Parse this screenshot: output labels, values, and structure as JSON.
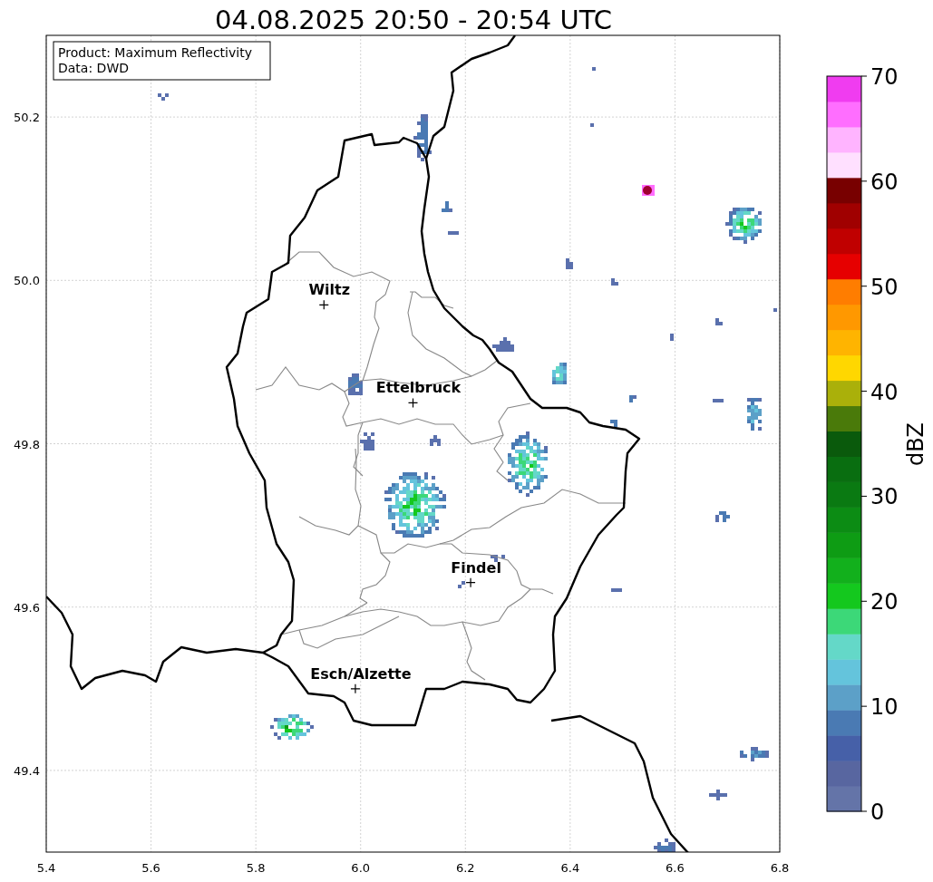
{
  "info_box": {
    "lines": [
      "Product: Maximum Reflectivity",
      "Data: DWD"
    ]
  },
  "chart_data": {
    "type": "scatter",
    "title": "04.08.2025 20:50 - 20:54 UTC",
    "xlim": [
      5.4,
      6.8
    ],
    "ylim": [
      49.3,
      50.3
    ],
    "xticks": [
      {
        "value": 5.4,
        "label": "5.4"
      },
      {
        "value": 5.6,
        "label": "5.6"
      },
      {
        "value": 5.8,
        "label": "5.8"
      },
      {
        "value": 6.0,
        "label": "6.0"
      },
      {
        "value": 6.2,
        "label": "6.2"
      },
      {
        "value": 6.4,
        "label": "6.4"
      },
      {
        "value": 6.6,
        "label": "6.6"
      },
      {
        "value": 6.8,
        "label": "6.8"
      }
    ],
    "yticks": [
      {
        "value": 49.4,
        "label": "49.4"
      },
      {
        "value": 49.6,
        "label": "49.6"
      },
      {
        "value": 49.8,
        "label": "49.8"
      },
      {
        "value": 50.0,
        "label": "50.0"
      },
      {
        "value": 50.2,
        "label": "50.2"
      }
    ],
    "x": [
      5.93,
      6.1,
      6.21,
      5.99
    ],
    "grid": true,
    "series": [
      {
        "color": "#000000",
        "values": [
          49.97,
          49.85,
          49.63,
          49.5
        ]
      }
    ],
    "annotations": [
      "Wiltz",
      "Ettelbruck",
      "Findel",
      "Esch/Alzette"
    ]
  },
  "colorbar": {
    "label": "dBZ",
    "ticks": [
      "70",
      "60",
      "50",
      "40",
      "30",
      "20",
      "10",
      "0"
    ],
    "bands": [
      {
        "color": "#6474a8"
      },
      {
        "color": "#5866a0"
      },
      {
        "color": "#4660a8"
      },
      {
        "color": "#4a7ab3"
      },
      {
        "color": "#5ca0c8"
      },
      {
        "color": "#64c4dc"
      },
      {
        "color": "#64d8c8"
      },
      {
        "color": "#3cd878"
      },
      {
        "color": "#14c81e"
      },
      {
        "color": "#12b01c"
      },
      {
        "color": "#0e9c14"
      },
      {
        "color": "#0c8c14"
      },
      {
        "color": "#0a7a12"
      },
      {
        "color": "#096e10"
      },
      {
        "color": "#0a5a0c"
      },
      {
        "color": "#4a7a0a"
      },
      {
        "color": "#aab00a"
      },
      {
        "color": "#ffd700"
      },
      {
        "color": "#ffb400"
      },
      {
        "color": "#ff9800"
      },
      {
        "color": "#ff7d00"
      },
      {
        "color": "#e60000"
      },
      {
        "color": "#c00000"
      },
      {
        "color": "#a00000"
      },
      {
        "color": "#780000"
      },
      {
        "color": "#ffe0ff"
      },
      {
        "color": "#ffb4ff"
      },
      {
        "color": "#ff6eff"
      },
      {
        "color": "#f03cf0"
      }
    ]
  }
}
